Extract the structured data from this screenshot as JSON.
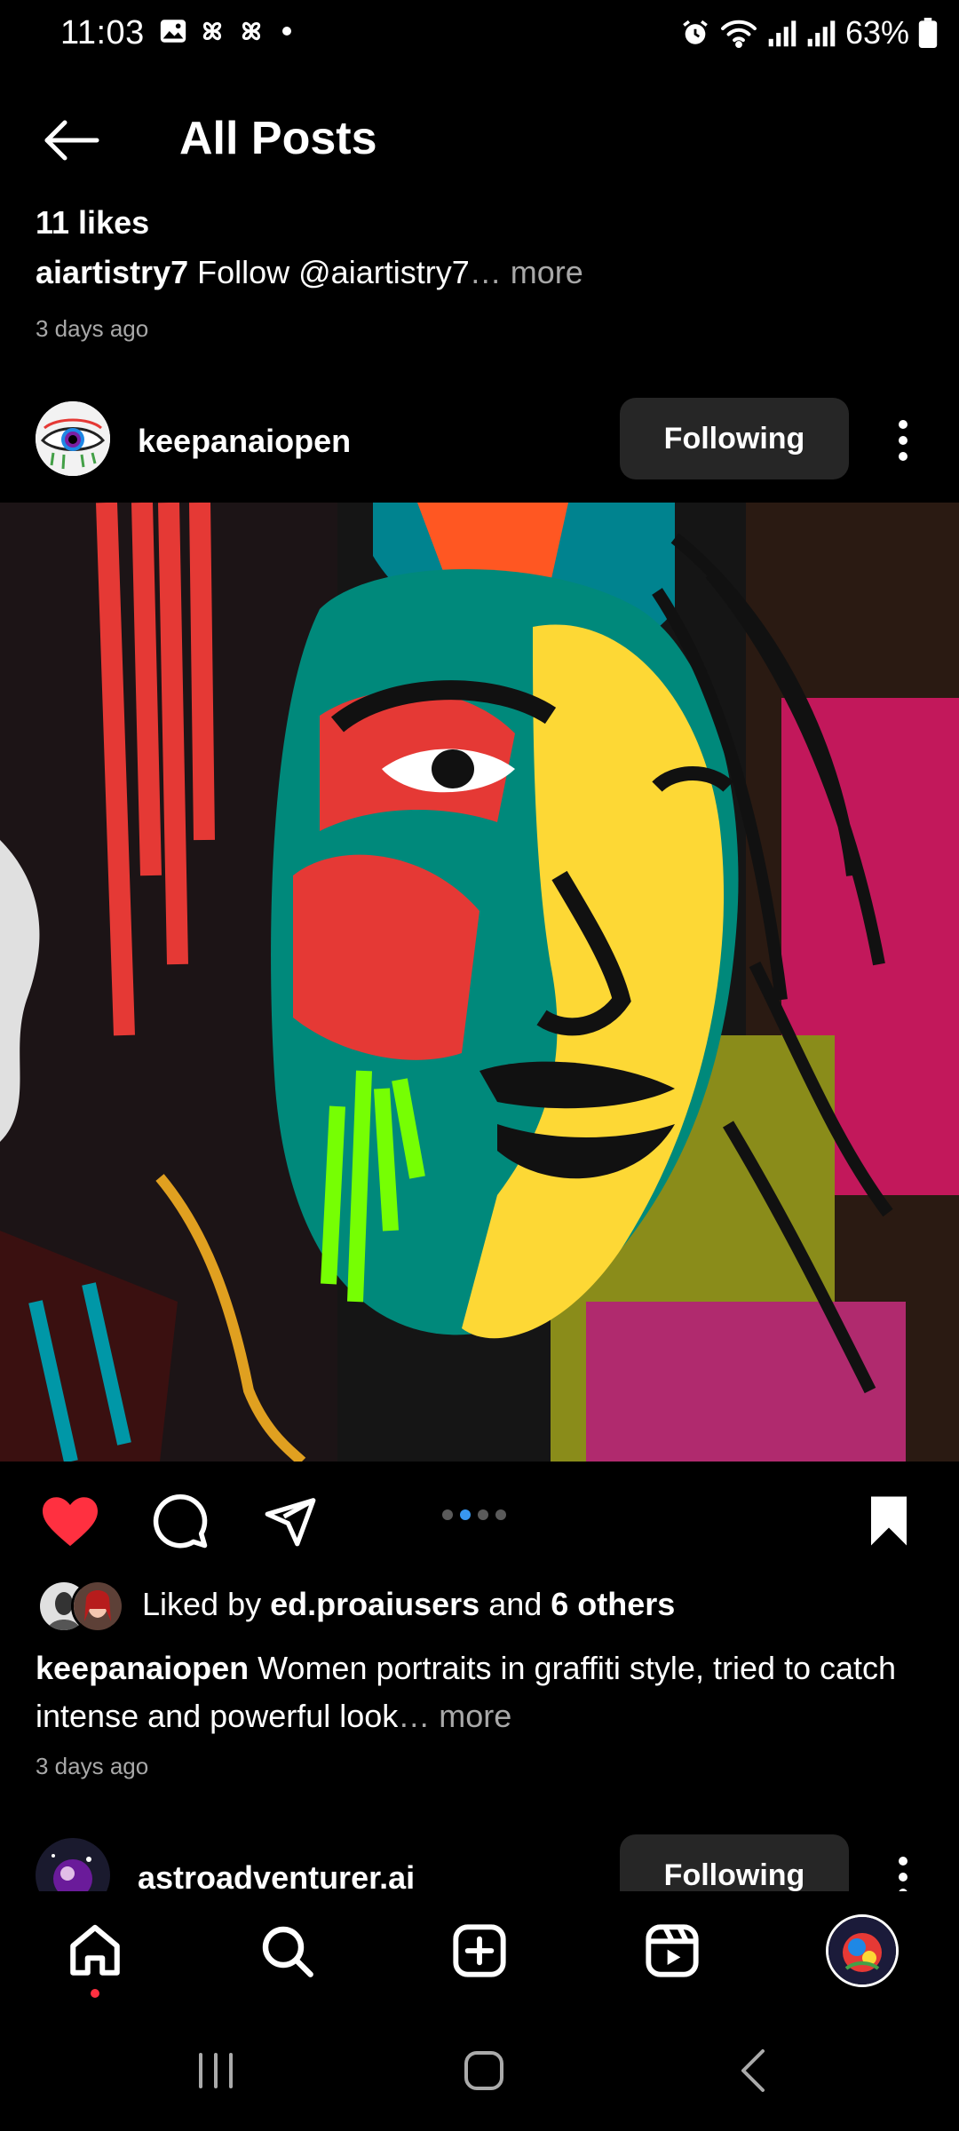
{
  "status_bar": {
    "time": "11:03",
    "battery": "63%"
  },
  "header": {
    "title": "All Posts"
  },
  "previous_post": {
    "likes": "11 likes",
    "username": "aiartistry7",
    "caption_text": " Follow @aiartistry7",
    "ellipsis": "… ",
    "more": "more",
    "time_ago": "3 days ago"
  },
  "post": {
    "username": "keepanaiopen",
    "follow_label": "Following",
    "carousel": {
      "count": 4,
      "active_index": 1
    },
    "liked_by": {
      "prefix": "Liked by ",
      "user": "ed.proaiusers",
      "mid": " and ",
      "others": "6 others"
    },
    "caption": {
      "username": "keepanaiopen",
      "text": " Women portraits in graffiti style, tried to catch intense and powerful look",
      "ellipsis": "… ",
      "more": "more"
    },
    "time_ago": "3 days ago",
    "liked": true,
    "saved": true
  },
  "next_post": {
    "username": "astroadventurer.ai",
    "follow_label": "Following"
  },
  "colors": {
    "like": "#ff3040",
    "active_dot": "#3897f0",
    "button_bg": "#262626"
  },
  "icons": {
    "bottom_nav": [
      "home-icon",
      "search-icon",
      "create-icon",
      "reels-icon",
      "profile-avatar"
    ],
    "actions": [
      "heart-icon",
      "comment-icon",
      "share-icon",
      "bookmark-icon"
    ]
  }
}
